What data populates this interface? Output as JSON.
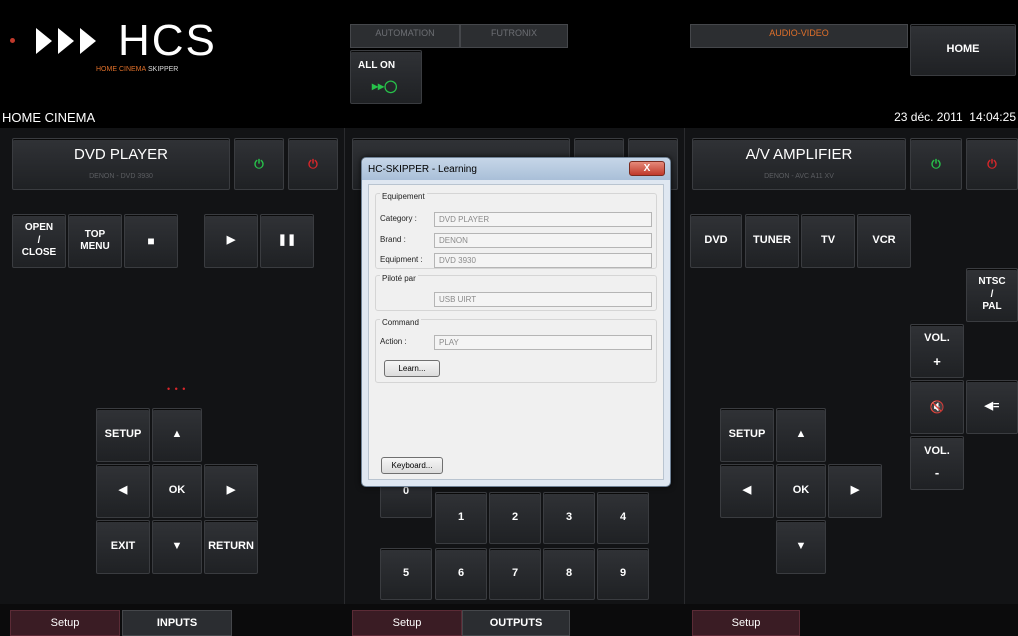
{
  "header": {
    "logo_text": "HCS",
    "logo_subtitle_1": "HOME CINEMA",
    "logo_subtitle_2": "SKIPPER",
    "section_title": "HOME CINEMA",
    "datetime": "23 déc. 2011  14:04:25",
    "tabs": {
      "automation": "AUTOMATION",
      "futronix": "FUTRONIX",
      "audio_video": "AUDIO-VIDEO"
    },
    "all_on": "ALL ON",
    "home": "HOME"
  },
  "left": {
    "device_title": "DVD PLAYER",
    "device_sub": "DENON - DVD 3930",
    "open_close": "OPEN\n/\nCLOSE",
    "top_menu": "TOP\nMENU",
    "indicator": "• • •",
    "setup": "SETUP",
    "ok": "OK",
    "exit": "EXIT",
    "return": "RETURN"
  },
  "right": {
    "device_title": "A/V AMPLIFIER",
    "device_sub": "DENON - AVC A11 XV",
    "inputs": [
      "DVD",
      "TUNER",
      "TV",
      "VCR"
    ],
    "ntsc_pal": "NTSC\n/\nPAL",
    "vol_plus_label": "VOL.",
    "vol_plus_sign": "+",
    "vol_minus_label": "VOL.",
    "vol_minus_sign": "-",
    "setup": "SETUP",
    "ok": "OK"
  },
  "middle": {
    "digits": [
      "0",
      "1",
      "2",
      "3",
      "4",
      "5",
      "6",
      "7",
      "8",
      "9"
    ]
  },
  "bottom": {
    "left_setup": "Setup",
    "left_tab": "INPUTS",
    "mid_setup": "Setup",
    "mid_tab": "OUTPUTS",
    "right_setup": "Setup"
  },
  "dialog": {
    "title": "HC-SKIPPER - Learning",
    "close": "X",
    "grp_equipement": "Equipement",
    "category_label": "Category :",
    "category_value": "DVD PLAYER",
    "brand_label": "Brand :",
    "brand_value": "DENON",
    "equipment_label": "Equipment :",
    "equipment_value": "DVD 3930",
    "grp_pilote": "Piloté par",
    "pilote_value": "USB UIRT",
    "grp_command": "Command",
    "action_label": "Action :",
    "action_value": "PLAY",
    "learn_button": "Learn...",
    "keyboard_button": "Keyboard..."
  },
  "colors": {
    "power_on": "#27c24a",
    "power_off": "#d8262a",
    "accent_orange": "#e0702a"
  }
}
